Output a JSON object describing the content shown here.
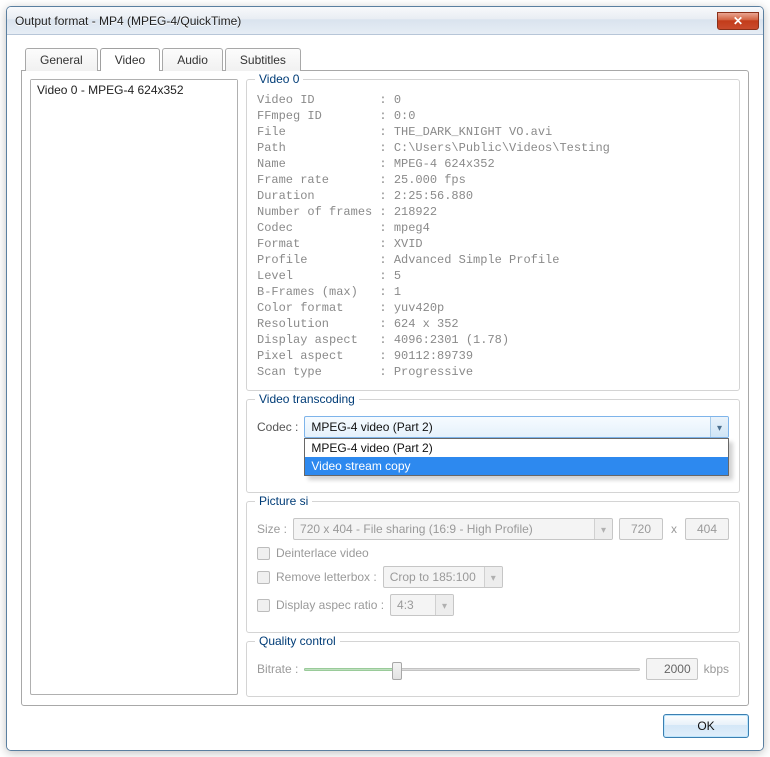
{
  "window": {
    "title": "Output format - MP4 (MPEG-4/QuickTime)"
  },
  "tabs": {
    "general": "General",
    "video": "Video",
    "audio": "Audio",
    "subtitles": "Subtitles"
  },
  "left": {
    "item0": "Video 0 - MPEG-4 624x352"
  },
  "video0": {
    "title": "Video 0",
    "props_block": "Video ID         : 0\nFFmpeg ID        : 0:0\nFile             : THE_DARK_KNIGHT VO.avi\nPath             : C:\\Users\\Public\\Videos\\Testing\nName             : MPEG-4 624x352\nFrame rate       : 25.000 fps\nDuration         : 2:25:56.880\nNumber of frames : 218922\nCodec            : mpeg4\nFormat           : XVID\nProfile          : Advanced Simple Profile\nLevel            : 5\nB-Frames (max)   : 1\nColor format     : yuv420p\nResolution       : 624 x 352\nDisplay aspect   : 4096:2301 (1.78)\nPixel aspect     : 90112:89739\nScan type        : Progressive"
  },
  "transcoding": {
    "title": "Video transcoding",
    "codec_label": "Codec :",
    "codec_value": "MPEG-4 video (Part 2)",
    "codec_options": {
      "opt0": "MPEG-4 video (Part 2)",
      "opt1": "Video stream copy"
    }
  },
  "picture": {
    "title_visible": "Picture si",
    "size_label": "Size :",
    "size_text": "720 x 404  -  File sharing (16:9 - High Profile)",
    "width": "720",
    "height": "404",
    "x_sep": "x",
    "deinterlace": "Deinterlace video",
    "remove_letterbox": "Remove letterbox :",
    "crop_text": "Crop to 185:100",
    "display_aspect": "Display aspec ratio :",
    "aspect_text": "4:3"
  },
  "quality": {
    "title": "Quality control",
    "bitrate_label": "Bitrate :",
    "bitrate_value": "2000",
    "bitrate_unit": "kbps"
  },
  "buttons": {
    "ok": "OK"
  }
}
